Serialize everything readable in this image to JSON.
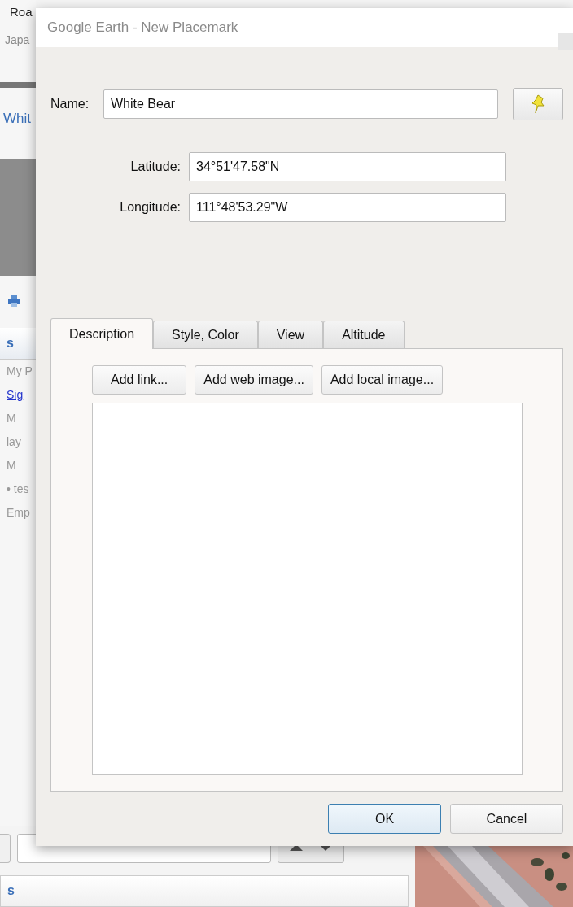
{
  "background_app": {
    "top_text": "Roa",
    "search_hint": "Japa",
    "place_title": "Whit",
    "panel_heading": "s",
    "list": [
      {
        "text": "My P",
        "kind": "dim"
      },
      {
        "text": "Sig",
        "kind": "link"
      },
      {
        "text": "M",
        "kind": "dim"
      },
      {
        "text": "lay",
        "kind": "dim"
      },
      {
        "text": "M",
        "kind": "dim"
      },
      {
        "text": "• tes",
        "kind": "dim"
      },
      {
        "text": "Emp",
        "kind": "dim"
      }
    ],
    "footer_heading": "s"
  },
  "dialog": {
    "title": "Google Earth - New Placemark",
    "name": {
      "label": "Name:",
      "value": "White Bear"
    },
    "latitude": {
      "label": "Latitude:",
      "value": "34°51'47.58\"N"
    },
    "longitude": {
      "label": "Longitude:",
      "value": "111°48'53.29\"W"
    },
    "tabs": [
      {
        "label": "Description",
        "selected": true
      },
      {
        "label": "Style, Color",
        "selected": false
      },
      {
        "label": "View",
        "selected": false
      },
      {
        "label": "Altitude",
        "selected": false
      }
    ],
    "tools": [
      "Add link...",
      "Add web image...",
      "Add local image..."
    ],
    "buttons": [
      {
        "label": "OK",
        "default": true
      },
      {
        "label": "Cancel",
        "default": false
      }
    ]
  }
}
